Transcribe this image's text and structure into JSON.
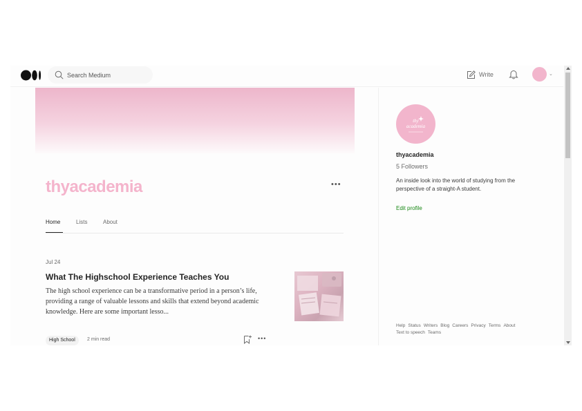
{
  "topbar": {
    "logo": "medium-logo",
    "search_placeholder": "Search Medium",
    "write_label": "Write"
  },
  "publication": {
    "name": "thyacademia",
    "more": "•••",
    "tabs": [
      {
        "label": "Home",
        "active": true
      },
      {
        "label": "Lists",
        "active": false
      },
      {
        "label": "About",
        "active": false
      }
    ]
  },
  "post": {
    "date": "Jul 24",
    "title": "What The Highschool Experience Teaches You",
    "excerpt": "The high school experience can be a transformative period in a person’s life, providing a range of valuable lessons and skills that extend beyond academic knowledge. Here are some important lesso...",
    "tag": "High School",
    "read_time": "2 min read",
    "more": "•••"
  },
  "sidebar": {
    "name": "thyacademia",
    "followers": "5 Followers",
    "bio": "An inside look into the world of studying from the perspective of a straight-A student.",
    "edit_profile": "Edit profile",
    "avatar_text": "thy academia",
    "footer_links": [
      "Help",
      "Status",
      "Writers",
      "Blog",
      "Careers",
      "Privacy",
      "Terms",
      "About",
      "Text to speech",
      "Teams"
    ]
  },
  "colors": {
    "brand_pink": "#f4b4cc",
    "edit_green": "#1a8917",
    "text_dark": "#242424",
    "text_muted": "#6b6b6b"
  }
}
